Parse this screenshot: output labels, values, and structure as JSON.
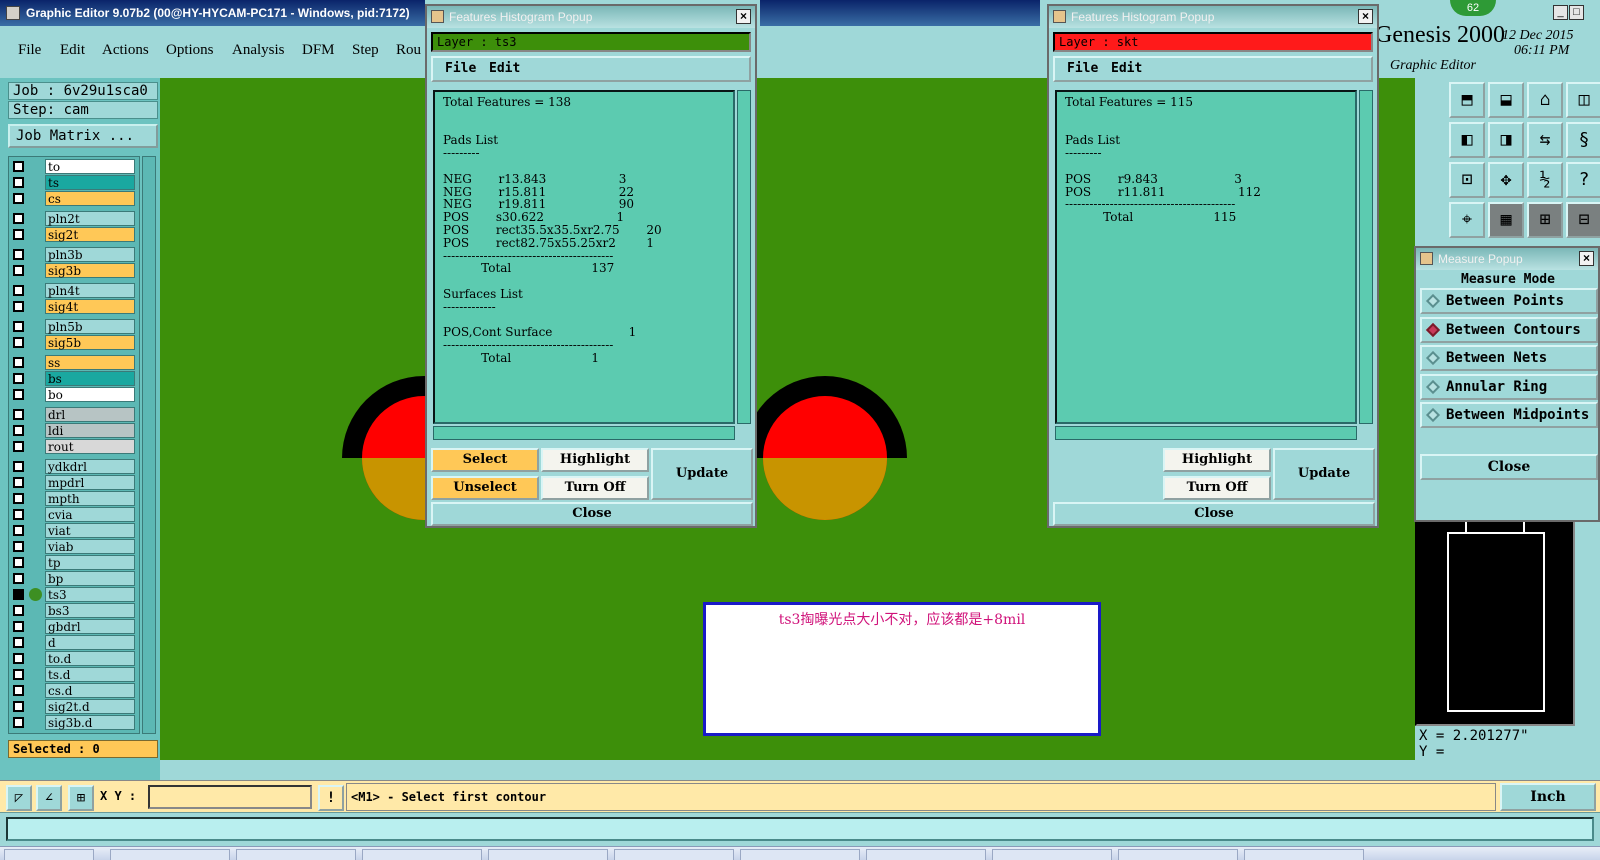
{
  "app": {
    "title": "Graphic Editor 9.07b2 (00@HY-HYCAM-PC171 - Windows, pid:7172)",
    "badge": "62",
    "brand": "Genesis 2000",
    "brand_sub": "Graphic Editor",
    "date": "12 Dec 2015",
    "time": "06:11 PM"
  },
  "menu": [
    "File",
    "Edit",
    "Actions",
    "Options",
    "Analysis",
    "DFM",
    "Step",
    "Rou"
  ],
  "job": {
    "job_line": "Job : 6v29u1sca0",
    "step_line": "Step: cam",
    "matrix_button": "Job Matrix ..."
  },
  "layers": [
    {
      "name": "to",
      "color": "#ffffff"
    },
    {
      "name": "ts",
      "color": "#1aa8a0"
    },
    {
      "name": "cs",
      "color": "#ffc857"
    },
    {
      "name": "pln2t",
      "color": "#9fd8d8"
    },
    {
      "name": "sig2t",
      "color": "#ffc857"
    },
    {
      "name": "pln3b",
      "color": "#9fd8d8"
    },
    {
      "name": "sig3b",
      "color": "#ffc857"
    },
    {
      "name": "pln4t",
      "color": "#9fd8d8"
    },
    {
      "name": "sig4t",
      "color": "#ffc857"
    },
    {
      "name": "pln5b",
      "color": "#9fd8d8"
    },
    {
      "name": "sig5b",
      "color": "#ffc857"
    },
    {
      "name": "ss",
      "color": "#ffc857"
    },
    {
      "name": "bs",
      "color": "#1aa8a0"
    },
    {
      "name": "bo",
      "color": "#ffffff"
    },
    {
      "name": "drl",
      "color": "#b7c4c4"
    },
    {
      "name": "ldi",
      "color": "#b7c4c4"
    },
    {
      "name": "rout",
      "color": "#d8d8d8"
    },
    {
      "name": "ydkdrl",
      "color": "#9fd8d8"
    },
    {
      "name": "mpdrl",
      "color": "#9fd8d8"
    },
    {
      "name": "mpth",
      "color": "#9fd8d8"
    },
    {
      "name": "cvia",
      "color": "#9fd8d8"
    },
    {
      "name": "viat",
      "color": "#9fd8d8"
    },
    {
      "name": "viab",
      "color": "#9fd8d8"
    },
    {
      "name": "tp",
      "color": "#9fd8d8"
    },
    {
      "name": "bp",
      "color": "#9fd8d8"
    },
    {
      "name": "ts3",
      "color": "#9fd8d8",
      "active": true
    },
    {
      "name": "bs3",
      "color": "#9fd8d8"
    },
    {
      "name": "gbdrl",
      "color": "#9fd8d8"
    },
    {
      "name": "d",
      "color": "#9fd8d8"
    },
    {
      "name": "to.d",
      "color": "#9fd8d8"
    },
    {
      "name": "ts.d",
      "color": "#9fd8d8"
    },
    {
      "name": "cs.d",
      "color": "#9fd8d8"
    },
    {
      "name": "sig2t.d",
      "color": "#9fd8d8"
    },
    {
      "name": "sig3b.d",
      "color": "#9fd8d8"
    }
  ],
  "selected_label": "Selected : 0",
  "popup1": {
    "title": "Features Histogram Popup",
    "layer_field": "Layer :  ts3",
    "layer_color": "#3d8f0a",
    "menu": [
      "File",
      "Edit"
    ],
    "report": "Total Features = 138\n\n\nPads List\n---------\n\nNEG       r13.843                   3\nNEG       r15.811                   22\nNEG       r19.811                   90\nPOS       s30.622                   1\nPOS       rect35.5x35.5xr2.75       20\nPOS       rect82.75x55.25xr2        1\n------------------------------------------\n          Total                     137\n\nSurfaces List\n-------------\n\nPOS,Cont Surface                    1\n------------------------------------------\n          Total                     1",
    "buttons": {
      "select": "Select",
      "highlight": "Highlight",
      "update": "Update",
      "unselect": "Unselect",
      "turn_off": "Turn Off",
      "close": "Close"
    }
  },
  "popup2": {
    "title": "Features Histogram Popup",
    "layer_field": "Layer :  skt",
    "layer_color": "#ff1a1a",
    "menu": [
      "File",
      "Edit"
    ],
    "report": "Total Features = 115\n\n\nPads List\n---------\n\nPOS       r9.843                    3\nPOS       r11.811                   112\n------------------------------------------\n          Total                     115",
    "buttons": {
      "highlight": "Highlight",
      "update": "Update",
      "turn_off": "Turn Off",
      "close": "Close"
    }
  },
  "annotation": "ts3掏曝光点大小不对，应该都是+8mil",
  "measure": {
    "title": "Measure Popup",
    "header": "Measure Mode",
    "options": [
      {
        "label": "Between Points",
        "selected": false
      },
      {
        "label": "Between Contours",
        "selected": true
      },
      {
        "label": "Between Nets",
        "selected": false
      },
      {
        "label": "Annular Ring",
        "selected": false
      },
      {
        "label": "Between Midpoints",
        "selected": false
      }
    ],
    "close": "Close"
  },
  "coords": {
    "x": "X = 2.201277\"",
    "y": "Y ="
  },
  "command": {
    "xy_label": "X Y :",
    "xy_value": "",
    "prompt": "<M1> - Select first contour",
    "units": "Inch"
  },
  "colors": {
    "canvas": "#3d8f0a",
    "panel": "#9fd8d8",
    "orange": "#ffc857",
    "pad_red": "#ff0000",
    "pad_dark_yellow": "#c89400"
  }
}
